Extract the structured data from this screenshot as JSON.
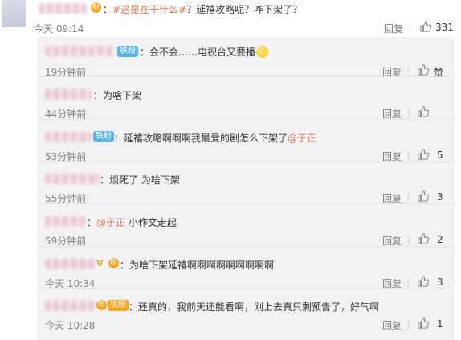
{
  "main_comment": {
    "hashtag": "#这是在干什么#",
    "text": "？延禧攻略呢？咋下架了？",
    "time": "今天 09:14",
    "reply_label": "回复",
    "like_count": "331"
  },
  "replies": [
    {
      "badge": "铁粉",
      "text": "：会不会……电视台又要播",
      "time": "19分钟前",
      "reply_label": "回复",
      "like_label": "赞",
      "like_count": ""
    },
    {
      "badge": "",
      "text": "：为啥下架",
      "time": "44分钟前",
      "reply_label": "回复",
      "like_label": "",
      "like_count": ""
    },
    {
      "badge": "铁粉",
      "text_before": "：延禧攻略啊啊啊我最爱的剧怎么下架了",
      "mention": "@于正",
      "time": "53分钟前",
      "reply_label": "回复",
      "like_label": "",
      "like_count": "5"
    },
    {
      "badge": "",
      "text": "：烦死了 为啥下架",
      "time": "55分钟前",
      "reply_label": "回复",
      "like_label": "",
      "like_count": "3"
    },
    {
      "badge": "",
      "text_before": "：",
      "mention": "@于正",
      "text_after": " 小作文走起",
      "time": "59分钟前",
      "reply_label": "回复",
      "like_label": "",
      "like_count": "2"
    },
    {
      "badge": "",
      "text": "：为啥下架延禧啊啊啊啊啊啊啊啊啊",
      "time": "今天 10:34",
      "reply_label": "回复",
      "like_label": "",
      "like_count": "3"
    },
    {
      "badge": "铁粉",
      "text": "：还真的，我前天还能看啊，刚上去真只剩预告了，好气啊",
      "time": "今天 10:28",
      "reply_label": "回复",
      "like_label": "",
      "like_count": "1"
    }
  ],
  "colors": {
    "link": "#eb7350",
    "badge_blue": "#5ab4e6",
    "badge_orange": "#f5a623",
    "reply_bg": "#f2f2f5"
  },
  "icons": [
    "avatar",
    "thumbs-up-icon",
    "vip-icon",
    "emoji-smile-icon",
    "fan-badge-icon"
  ]
}
